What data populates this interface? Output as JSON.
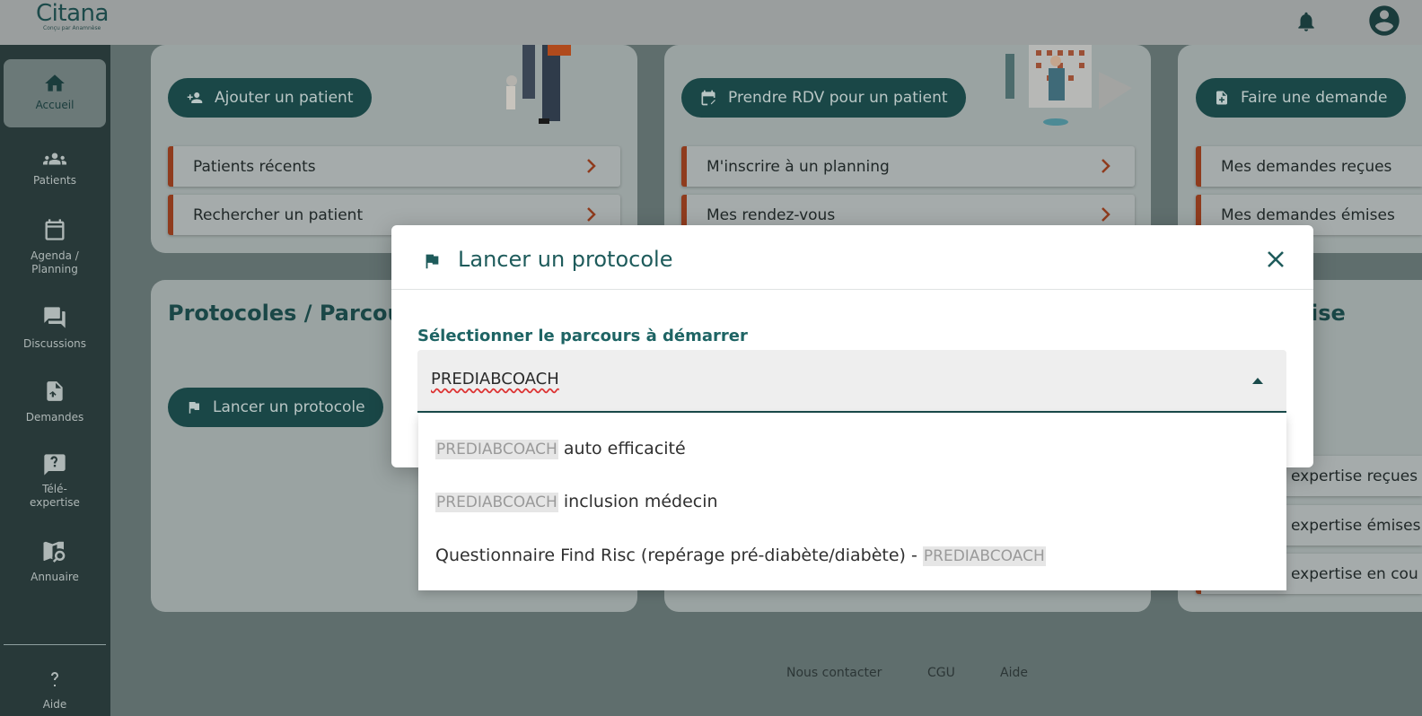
{
  "app": {
    "logo_text": "Citana",
    "logo_sub": "Conçu par Anamnèse"
  },
  "header": {
    "notifications_icon": "bell-icon",
    "account_icon": "account-circle-icon"
  },
  "sidebar": {
    "items": [
      {
        "label": "Accueil",
        "icon": "home-icon"
      },
      {
        "label": "Patients",
        "icon": "people-icon"
      },
      {
        "label": "Agenda /",
        "label2": "Planning",
        "icon": "calendar-icon"
      },
      {
        "label": "Discussions",
        "icon": "chat-icon"
      },
      {
        "label": "Demandes",
        "icon": "document-arrow-icon"
      },
      {
        "label": "Télé-",
        "label2": "expertise",
        "icon": "question-chat-icon"
      },
      {
        "label": "Annuaire",
        "icon": "map-search-icon"
      },
      {
        "label": "Aide",
        "icon": "help-icon"
      }
    ]
  },
  "panels": {
    "patients": {
      "button": "Ajouter un patient",
      "links": [
        "Patients récents",
        "Rechercher un patient"
      ]
    },
    "agenda": {
      "button": "Prendre RDV pour un patient",
      "links": [
        "M'inscrire à un planning",
        "Mes rendez-vous"
      ]
    },
    "demandes": {
      "button": "Faire une demande",
      "links": [
        "Mes demandes reçues",
        "Mes demandes émises"
      ]
    },
    "protocoles": {
      "title": "Protocoles / Parcour",
      "button": "Lancer un protocole"
    },
    "teleexpertise": {
      "title_tail": "ise",
      "links": [
        "expertise reçues",
        "expertise émises",
        "expertise en cou"
      ]
    }
  },
  "footer": {
    "links": [
      "Nous contacter",
      "CGU",
      "Aide"
    ]
  },
  "modal": {
    "title": "Lancer un protocole",
    "field_label": "Sélectionner le parcours à démarrer",
    "select_value": "PREDIABCOACH",
    "options": [
      {
        "highlight": "PREDIABCOACH",
        "text": " auto efficacité"
      },
      {
        "highlight": "PREDIABCOACH",
        "text": " inclusion médecin"
      },
      {
        "text": "Questionnaire Find Risc (repérage pré-diabète/diabète) - ",
        "highlight_after": "PREDIABCOACH"
      }
    ]
  },
  "colors": {
    "primary": "#1e5b5b",
    "accent": "#e0562a",
    "sidebar_bg": "#283939"
  }
}
